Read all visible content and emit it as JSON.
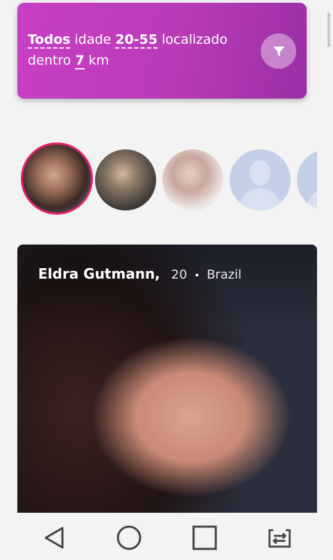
{
  "filter": {
    "gender_value": "Todos",
    "age_label": "idade",
    "age_value": "20-55",
    "location_label": "localizado",
    "within_label": "dentro",
    "distance_value": "7",
    "distance_unit": "km",
    "button_icon": "filter-icon"
  },
  "stories": [
    {
      "type": "photo",
      "active": true
    },
    {
      "type": "photo",
      "active": false
    },
    {
      "type": "photo",
      "active": false
    },
    {
      "type": "placeholder",
      "active": false
    },
    {
      "type": "placeholder",
      "active": false
    }
  ],
  "profile": {
    "name": "Eldra Gutmann,",
    "age": "20",
    "separator": "•",
    "country": "Brazil"
  },
  "navbar": {
    "items": [
      "back-icon",
      "home-icon",
      "recents-icon",
      "switch-screen-icon"
    ]
  },
  "colors": {
    "accent": "#c03ec0",
    "story_ring": "#e0226f"
  }
}
